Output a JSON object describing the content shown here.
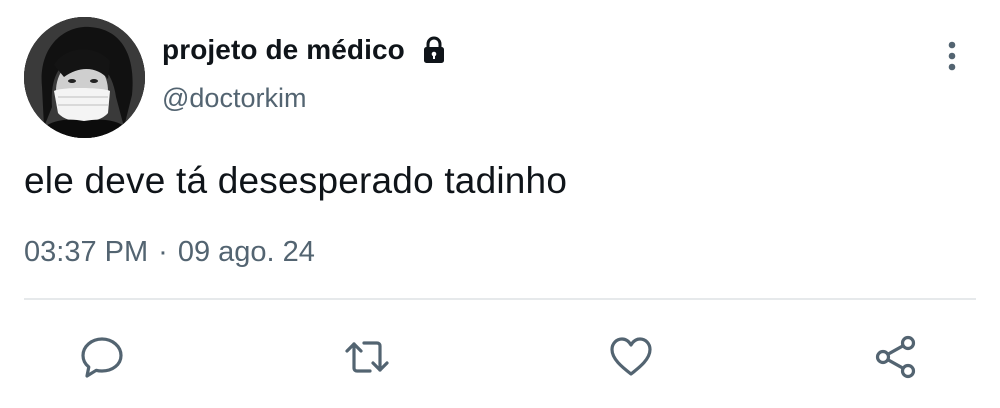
{
  "tweet": {
    "author": {
      "display_name": "projeto de médico",
      "handle": "@doctorkim",
      "protected_icon": "lock-icon",
      "avatar": "avatar-person-with-mask"
    },
    "text": "ele deve tá desesperado tadinho",
    "time": "03:37 PM",
    "separator": "·",
    "date": "09 ago. 24",
    "more_icon": "more-vertical-icon",
    "actions": [
      {
        "name": "reply",
        "icon": "reply-bubble-icon"
      },
      {
        "name": "retweet",
        "icon": "retweet-icon"
      },
      {
        "name": "like",
        "icon": "heart-icon"
      },
      {
        "name": "share",
        "icon": "share-icon"
      }
    ]
  },
  "colors": {
    "text_primary": "#0f1419",
    "text_secondary": "#536471",
    "divider": "#e6e9eb",
    "background": "#ffffff"
  }
}
